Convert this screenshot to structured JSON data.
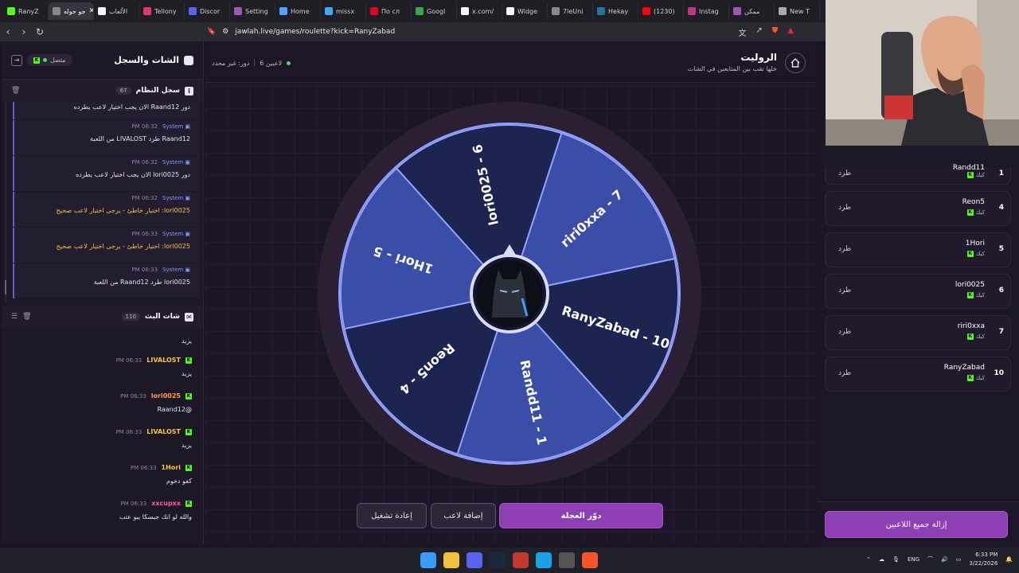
{
  "browser": {
    "tabs": [
      {
        "label": "RanyZ",
        "color": "#53fc18",
        "active": false
      },
      {
        "label": "جو حوله",
        "color": "#888",
        "active": true
      },
      {
        "label": "الألعاب",
        "color": "#ffffff",
        "active": false
      },
      {
        "label": "Tellony",
        "color": "#e03a6a",
        "active": false
      },
      {
        "label": "Discor",
        "color": "#5865f2",
        "active": false
      },
      {
        "label": "Setting",
        "color": "#9b59b6",
        "active": false
      },
      {
        "label": "Home",
        "color": "#4aa3ff",
        "active": false
      },
      {
        "label": "missx",
        "color": "#3fa9f5",
        "active": false
      },
      {
        "label": "По сл",
        "color": "#e60023",
        "active": false
      },
      {
        "label": "Googl",
        "color": "#34a853",
        "active": false
      },
      {
        "label": "x.com/",
        "color": "#ffffff",
        "active": false
      },
      {
        "label": "Widge",
        "color": "#ffffff",
        "active": false
      },
      {
        "label": "7leUni",
        "color": "#888",
        "active": false
      },
      {
        "label": "Hekay",
        "color": "#21759b",
        "active": false
      },
      {
        "label": "(1230)",
        "color": "#ff0000",
        "active": false
      },
      {
        "label": "Instag",
        "color": "#c13584",
        "active": false
      },
      {
        "label": "ممكن",
        "color": "#9b59b6",
        "active": false
      },
      {
        "label": "New T",
        "color": "#aaa",
        "active": false
      }
    ],
    "url": "jawlah.live/games/roulette?kick=RanyZabad"
  },
  "chat": {
    "title": "الشات والسجل",
    "status": "متصل",
    "system_log": {
      "title": "سجل النظام",
      "count": "67",
      "messages": [
        {
          "time": "",
          "text": "دور Raand12 الان يجب اختيار لاعب يطرده",
          "warn": false
        },
        {
          "time": "06:32 PM",
          "text": "Raand12 طرد LIVALOST من اللعبة",
          "warn": false
        },
        {
          "time": "06:32 PM",
          "text": "دور lori0025 الان يجب اختيار لاعب يطرده",
          "warn": false
        },
        {
          "time": "06:32 PM",
          "text": "lori0025: اختيار خاطئ - يرجى اختيار لاعب صحيح",
          "warn": true
        },
        {
          "time": "06:33 PM",
          "text": "lori0025: اختيار خاطئ - يرجى اختيار لاعب صحيح",
          "warn": true
        },
        {
          "time": "06:33 PM",
          "text": "lori0025 طرد Raand12 من اللعبة",
          "warn": false
        }
      ],
      "sender": "System"
    },
    "stream_chat": {
      "title": "شات البث",
      "count": "110",
      "messages": [
        {
          "user": "",
          "time": "",
          "text": "يزيد",
          "color": "#fff"
        },
        {
          "user": "LIVALOST",
          "time": "06:33 PM",
          "text": "يزيد",
          "color": "#f5c542"
        },
        {
          "user": "lori0025",
          "time": "06:33 PM",
          "text": "@Raand12",
          "color": "#ff9d3f"
        },
        {
          "user": "LIVALOST",
          "time": "06:33 PM",
          "text": "يزيد",
          "color": "#f5c542"
        },
        {
          "user": "1Hori",
          "time": "06:33 PM",
          "text": "كفو دخوم",
          "color": "#f5c542"
        },
        {
          "user": "xxcupxx",
          "time": "06:33 PM",
          "text": "والله لو انك جيسكا يبو عتب",
          "color": "#ff5fa2"
        }
      ]
    }
  },
  "game": {
    "title": "الروليت",
    "subtitle": "خلها تقب بين المتابعين في الشات",
    "players_count": "6 لاعبين",
    "turn": "دور: غير محدد",
    "wheel_segments": [
      "RanyZabad - 10",
      "Randd11 - 1",
      "Reon5 - 4",
      "1Hori - 5",
      "lori0025 - 6",
      "riri0xxa - 7"
    ],
    "spin_label": "دوّر العجلة",
    "add_label": "إضافة لاعب",
    "reset_label": "إعادة تشغيل"
  },
  "players": {
    "kick_label": "طرد",
    "platform": "كيك",
    "list": [
      {
        "num": "1",
        "name": "Randd11"
      },
      {
        "num": "4",
        "name": "Reon5"
      },
      {
        "num": "5",
        "name": "1Hori"
      },
      {
        "num": "6",
        "name": "lori0025"
      },
      {
        "num": "7",
        "name": "riri0xxa"
      },
      {
        "num": "10",
        "name": "RanyZabad"
      }
    ],
    "remove_all": "إزالة جميع اللاعبين"
  },
  "taskbar": {
    "lang": "ENG",
    "time": "6:33 PM",
    "date": "3/22/2026"
  }
}
